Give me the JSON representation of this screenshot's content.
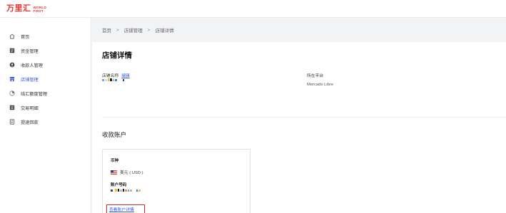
{
  "brand": {
    "name_cn": "万里汇",
    "name_en_line1": "WORLD",
    "name_en_line2": "FIRST",
    "color": "#e8312c"
  },
  "sidebar": {
    "items": [
      {
        "label": "首页",
        "icon": "home-icon",
        "active": false
      },
      {
        "label": "资金管理",
        "icon": "funds-icon",
        "active": false
      },
      {
        "label": "收款人管理",
        "icon": "payee-icon",
        "active": false
      },
      {
        "label": "店铺管理",
        "icon": "store-icon",
        "active": true
      },
      {
        "label": "结汇额度管理",
        "icon": "exchange-quota-icon",
        "active": false
      },
      {
        "label": "交易明细",
        "icon": "transactions-icon",
        "active": false
      },
      {
        "label": "提速回款",
        "icon": "fast-repayment-icon",
        "active": false
      }
    ]
  },
  "breadcrumb": {
    "items": [
      "首页",
      "店铺管理",
      "店铺详情"
    ],
    "separator": ">"
  },
  "page": {
    "title": "店铺详情",
    "store_name_label": "店铺名称",
    "edit_label": "编辑",
    "platform_label": "所在平台",
    "platform_value": "Mercado Libre"
  },
  "receiving_account": {
    "section_title": "收款账户",
    "currency_label": "币种",
    "currency_value": "美元 ( USD )",
    "account_number_label": "账户号码",
    "view_details_label": "查看账户详情"
  },
  "colors": {
    "accent": "#3b58d8",
    "highlight_border": "#d9232f"
  }
}
